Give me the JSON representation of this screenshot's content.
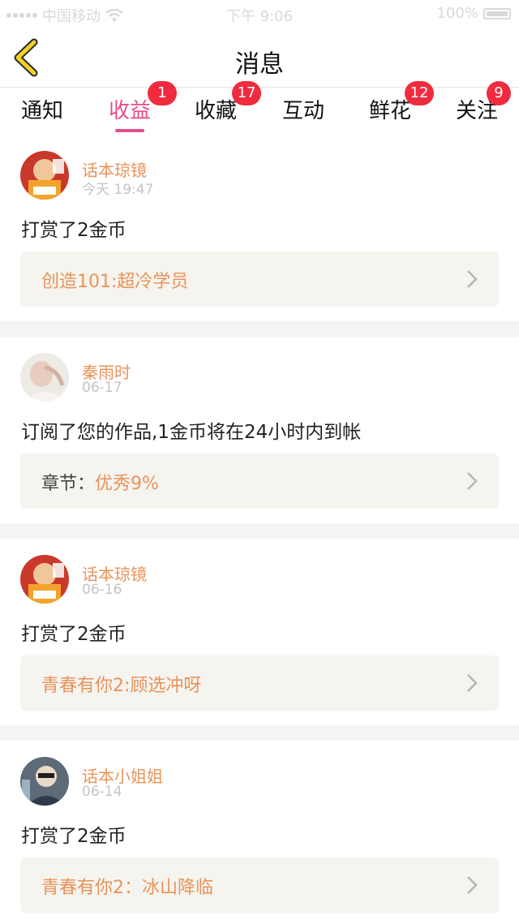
{
  "status_bar": {
    "carrier": "中国移动",
    "time": "下午 9:06",
    "battery": "100%"
  },
  "header": {
    "title": "消息",
    "back_icon": "chevron-left-icon"
  },
  "tabs": [
    {
      "label": "通知",
      "badge": ""
    },
    {
      "label": "收益",
      "badge": "1",
      "active": true
    },
    {
      "label": "收藏",
      "badge": "17"
    },
    {
      "label": "互动",
      "badge": ""
    },
    {
      "label": "鲜花",
      "badge": "12"
    },
    {
      "label": "关注",
      "badge": "9"
    }
  ],
  "colors": {
    "accent_pink": "#e64d8a",
    "name_orange": "#e8935a",
    "badge_red": "#ef2b3d"
  },
  "messages": [
    {
      "name": "话本琼镜",
      "time": "今天 19:47",
      "action": "打赏了2金币",
      "link_prefix": "",
      "link_text": "创造101:超冷学员"
    },
    {
      "name": "秦雨时",
      "time": "06-17",
      "action": "订阅了您的作品,1金币将在24小时内到帐",
      "link_prefix": "章节：",
      "link_text": "优秀9%"
    },
    {
      "name": "话本琼镜",
      "time": "06-16",
      "action": "打赏了2金币",
      "link_prefix": "",
      "link_text": "青春有你2:顾选冲呀"
    },
    {
      "name": "话本小姐姐",
      "time": "06-14",
      "action": "打赏了2金币",
      "link_prefix": "",
      "link_text": "青春有你2：冰山降临"
    }
  ]
}
